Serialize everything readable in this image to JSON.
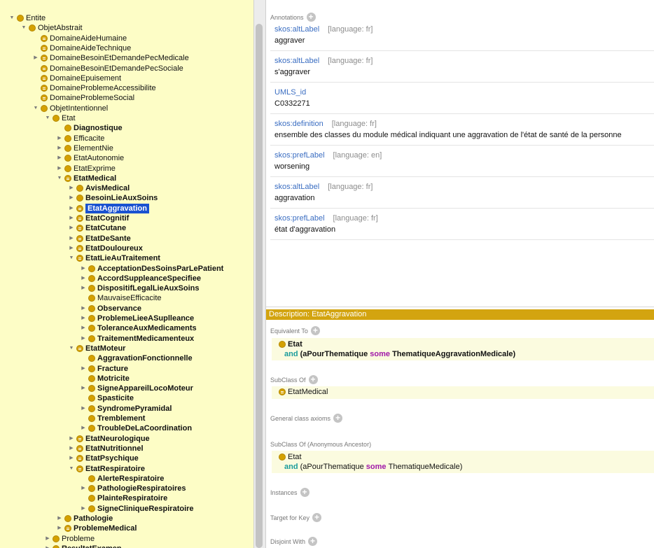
{
  "tree": {
    "rows": [
      {
        "label": "Entite",
        "depth": 0,
        "expand": "open",
        "icon": "circle",
        "bold": false,
        "selected": false
      },
      {
        "label": "ObjetAbstrait",
        "depth": 1,
        "expand": "open",
        "icon": "circle",
        "bold": false,
        "selected": false
      },
      {
        "label": "DomaineAideHumaine",
        "depth": 2,
        "expand": "none",
        "icon": "equivalent",
        "bold": false,
        "selected": false
      },
      {
        "label": "DomaineAideTechnique",
        "depth": 2,
        "expand": "none",
        "icon": "equivalent",
        "bold": false,
        "selected": false
      },
      {
        "label": "DomaineBesoinEtDemandePecMedicale",
        "depth": 2,
        "expand": "closed",
        "icon": "equivalent",
        "bold": false,
        "selected": false
      },
      {
        "label": "DomaineBesoinEtDemandePecSociale",
        "depth": 2,
        "expand": "none",
        "icon": "equivalent",
        "bold": false,
        "selected": false
      },
      {
        "label": "DomaineEpuisement",
        "depth": 2,
        "expand": "none",
        "icon": "equivalent",
        "bold": false,
        "selected": false
      },
      {
        "label": "DomaineProblemeAccessibilite",
        "depth": 2,
        "expand": "none",
        "icon": "equivalent",
        "bold": false,
        "selected": false
      },
      {
        "label": "DomaineProblemeSocial",
        "depth": 2,
        "expand": "none",
        "icon": "equivalent",
        "bold": false,
        "selected": false
      },
      {
        "label": "ObjetIntentionnel",
        "depth": 2,
        "expand": "open",
        "icon": "circle",
        "bold": false,
        "selected": false
      },
      {
        "label": "Etat",
        "depth": 3,
        "expand": "open",
        "icon": "circle",
        "bold": false,
        "selected": false
      },
      {
        "label": "Diagnostique",
        "depth": 4,
        "expand": "none",
        "icon": "circle",
        "bold": true,
        "selected": false
      },
      {
        "label": "Efficacite",
        "depth": 4,
        "expand": "closed",
        "icon": "circle",
        "bold": false,
        "selected": false
      },
      {
        "label": "ElementNie",
        "depth": 4,
        "expand": "closed",
        "icon": "circle",
        "bold": false,
        "selected": false
      },
      {
        "label": "EtatAutonomie",
        "depth": 4,
        "expand": "closed",
        "icon": "circle",
        "bold": false,
        "selected": false
      },
      {
        "label": "EtatExprime",
        "depth": 4,
        "expand": "closed",
        "icon": "circle",
        "bold": false,
        "selected": false
      },
      {
        "label": "EtatMedical",
        "depth": 4,
        "expand": "open",
        "icon": "equivalent",
        "bold": true,
        "selected": false
      },
      {
        "label": "AvisMedical",
        "depth": 5,
        "expand": "closed",
        "icon": "circle",
        "bold": true,
        "selected": false
      },
      {
        "label": "BesoinLieAuxSoins",
        "depth": 5,
        "expand": "closed",
        "icon": "circle",
        "bold": true,
        "selected": false
      },
      {
        "label": "EtatAggravation",
        "depth": 5,
        "expand": "closed",
        "icon": "equivalent",
        "bold": true,
        "selected": true
      },
      {
        "label": "EtatCognitif",
        "depth": 5,
        "expand": "closed",
        "icon": "equivalent",
        "bold": true,
        "selected": false
      },
      {
        "label": "EtatCutane",
        "depth": 5,
        "expand": "closed",
        "icon": "equivalent",
        "bold": true,
        "selected": false
      },
      {
        "label": "EtatDeSante",
        "depth": 5,
        "expand": "closed",
        "icon": "equivalent",
        "bold": true,
        "selected": false
      },
      {
        "label": "EtatDouloureux",
        "depth": 5,
        "expand": "closed",
        "icon": "equivalent",
        "bold": true,
        "selected": false
      },
      {
        "label": "EtatLieAuTraitement",
        "depth": 5,
        "expand": "open",
        "icon": "equivalent",
        "bold": true,
        "selected": false
      },
      {
        "label": "AcceptationDesSoinsParLePatient",
        "depth": 6,
        "expand": "closed",
        "icon": "circle",
        "bold": true,
        "selected": false
      },
      {
        "label": "AccordSuppleanceSpecifiee",
        "depth": 6,
        "expand": "closed",
        "icon": "circle",
        "bold": true,
        "selected": false
      },
      {
        "label": "DispositifLegalLieAuxSoins",
        "depth": 6,
        "expand": "closed",
        "icon": "circle",
        "bold": true,
        "selected": false
      },
      {
        "label": "MauvaiseEfficacite",
        "depth": 6,
        "expand": "none",
        "icon": "circle",
        "bold": false,
        "selected": false
      },
      {
        "label": "Observance",
        "depth": 6,
        "expand": "closed",
        "icon": "circle",
        "bold": true,
        "selected": false
      },
      {
        "label": "ProblemeLieeASuplleance",
        "depth": 6,
        "expand": "closed",
        "icon": "circle",
        "bold": true,
        "selected": false
      },
      {
        "label": "ToleranceAuxMedicaments",
        "depth": 6,
        "expand": "closed",
        "icon": "circle",
        "bold": true,
        "selected": false
      },
      {
        "label": "TraitementMedicamenteux",
        "depth": 6,
        "expand": "closed",
        "icon": "circle",
        "bold": true,
        "selected": false
      },
      {
        "label": "EtatMoteur",
        "depth": 5,
        "expand": "open",
        "icon": "equivalent",
        "bold": true,
        "selected": false
      },
      {
        "label": "AggravationFonctionnelle",
        "depth": 6,
        "expand": "none",
        "icon": "circle",
        "bold": true,
        "selected": false
      },
      {
        "label": "Fracture",
        "depth": 6,
        "expand": "closed",
        "icon": "circle",
        "bold": true,
        "selected": false
      },
      {
        "label": "Motricite",
        "depth": 6,
        "expand": "none",
        "icon": "circle",
        "bold": true,
        "selected": false
      },
      {
        "label": "SigneAppareilLocoMoteur",
        "depth": 6,
        "expand": "closed",
        "icon": "circle",
        "bold": true,
        "selected": false
      },
      {
        "label": "Spasticite",
        "depth": 6,
        "expand": "none",
        "icon": "circle",
        "bold": true,
        "selected": false
      },
      {
        "label": "SyndromePyramidal",
        "depth": 6,
        "expand": "closed",
        "icon": "circle",
        "bold": true,
        "selected": false
      },
      {
        "label": "Tremblement",
        "depth": 6,
        "expand": "none",
        "icon": "circle",
        "bold": true,
        "selected": false
      },
      {
        "label": "TroubleDeLaCoordination",
        "depth": 6,
        "expand": "closed",
        "icon": "circle",
        "bold": true,
        "selected": false
      },
      {
        "label": "EtatNeurologique",
        "depth": 5,
        "expand": "closed",
        "icon": "equivalent",
        "bold": true,
        "selected": false
      },
      {
        "label": "EtatNutritionnel",
        "depth": 5,
        "expand": "closed",
        "icon": "equivalent",
        "bold": true,
        "selected": false
      },
      {
        "label": "EtatPsychique",
        "depth": 5,
        "expand": "closed",
        "icon": "equivalent",
        "bold": true,
        "selected": false
      },
      {
        "label": "EtatRespiratoire",
        "depth": 5,
        "expand": "open",
        "icon": "equivalent",
        "bold": true,
        "selected": false
      },
      {
        "label": "AlerteRespiratoire",
        "depth": 6,
        "expand": "none",
        "icon": "circle",
        "bold": true,
        "selected": false
      },
      {
        "label": "PathologieRespiratoires",
        "depth": 6,
        "expand": "closed",
        "icon": "circle",
        "bold": true,
        "selected": false
      },
      {
        "label": "PlainteRespiratoire",
        "depth": 6,
        "expand": "none",
        "icon": "circle",
        "bold": true,
        "selected": false
      },
      {
        "label": "SigneCliniqueRespiratoire",
        "depth": 6,
        "expand": "closed",
        "icon": "circle",
        "bold": true,
        "selected": false
      },
      {
        "label": "Pathologie",
        "depth": 4,
        "expand": "closed",
        "icon": "circle",
        "bold": true,
        "selected": false
      },
      {
        "label": "ProblemeMedical",
        "depth": 4,
        "expand": "closed",
        "icon": "equivalent",
        "bold": true,
        "selected": false
      },
      {
        "label": "Probleme",
        "depth": 3,
        "expand": "closed",
        "icon": "circle",
        "bold": false,
        "selected": false
      },
      {
        "label": "ResultatExamen",
        "depth": 3,
        "expand": "closed",
        "icon": "circle",
        "bold": true,
        "selected": false
      }
    ]
  },
  "annotations": {
    "title": "Annotations",
    "items": [
      {
        "property": "skos:altLabel",
        "lang": "[language: fr]",
        "value": "aggraver"
      },
      {
        "property": "skos:altLabel",
        "lang": "[language: fr]",
        "value": "s'aggraver"
      },
      {
        "property": "UMLS_id",
        "lang": "",
        "value": "C0332271"
      },
      {
        "property": "skos:definition",
        "lang": "[language: fr]",
        "value": "ensemble des classes du module médical indiquant une aggravation de l'état de santé de la personne"
      },
      {
        "property": "skos:prefLabel",
        "lang": "[language: en]",
        "value": "worsening"
      },
      {
        "property": "skos:altLabel",
        "lang": "[language: fr]",
        "value": "aggravation"
      },
      {
        "property": "skos:prefLabel",
        "lang": "[language: fr]",
        "value": "état d'aggravation"
      }
    ]
  },
  "description": {
    "header": "Description: EtatAggravation",
    "equivalent_to": {
      "title": "Equivalent To",
      "class": "Etat",
      "and": "and",
      "property": "(aPourThematique",
      "some": "some",
      "filler": "ThematiqueAggravationMedicale)"
    },
    "subclass_of": {
      "title": "SubClass Of",
      "class": "EtatMedical"
    },
    "general_axioms": {
      "title": "General class axioms"
    },
    "anonymous_ancestor": {
      "title": "SubClass Of (Anonymous Ancestor)",
      "class": "Etat",
      "and": "and",
      "property": "(aPourThematique",
      "some": "some",
      "filler": "ThematiqueMedicale)"
    },
    "instances": {
      "title": "Instances"
    },
    "target_for_key": {
      "title": "Target for Key"
    },
    "disjoint_with": {
      "title": "Disjoint With"
    }
  },
  "colors": {
    "tree_background": "#fdfdc6",
    "class_icon": "#d4a100",
    "selection": "#1a52d0",
    "description_header": "#d3a410",
    "annotation_property": "#3b6ec2",
    "keyword_and": "#1a9c9c",
    "keyword_some": "#a018a8"
  }
}
